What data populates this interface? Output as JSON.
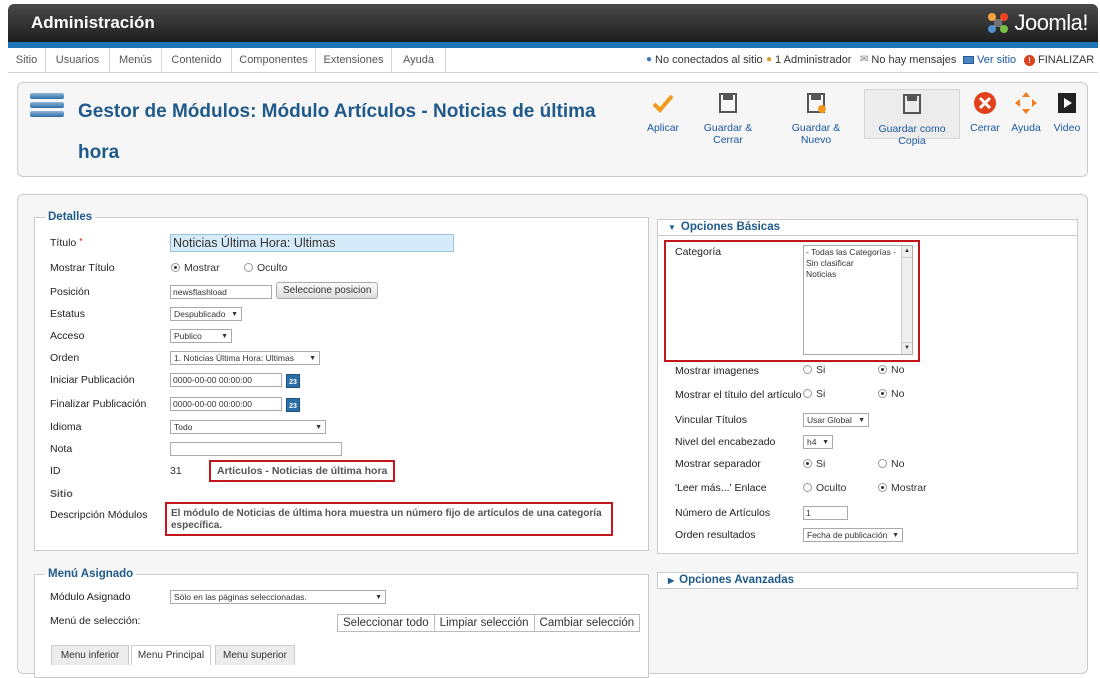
{
  "header": {
    "title": "Administración",
    "logo_text": "Joomla!"
  },
  "menu": [
    "Sitio",
    "Usuarios",
    "Menús",
    "Contenido",
    "Componentes",
    "Extensiones",
    "Ayuda"
  ],
  "status": {
    "offline": "No conectados al sitio",
    "admins": "1 Administrador",
    "messages": "No hay mensajes",
    "view_site": "Ver sitio",
    "logout": "FINALIZAR"
  },
  "page_title": "Gestor de Módulos: Módulo Artículos - Noticias de última hora",
  "toolbar": {
    "apply": "Aplicar",
    "save_close": "Guardar & Cerrar",
    "save_new": "Guardar & Nuevo",
    "save_copy": "Guardar como Copia",
    "close": "Cerrar",
    "help": "Ayuda",
    "video": "Video"
  },
  "details": {
    "legend": "Detalles",
    "title_label": "Título",
    "required_mark": "*",
    "title_value": "Noticias Última Hora: Ultimas",
    "show_title_label": "Mostrar Título",
    "show_title_opt1": "Mostrar",
    "show_title_opt2": "Oculto",
    "position_label": "Posición",
    "position_value": "newsflashload",
    "position_button": "Seleccione posicion",
    "status_label": "Estatus",
    "status_value": "Despublicado",
    "access_label": "Acceso",
    "access_value": "Publico",
    "order_label": "Orden",
    "order_value": "1. Noticias Última Hora: Ultimas",
    "start_label": "Iniciar Publicación",
    "start_value": "0000-00-00 00:00:00",
    "end_label": "Finalizar Publicación",
    "end_value": "0000-00-00 00:00:00",
    "calendar_day": "23",
    "language_label": "Idioma",
    "language_value": "Todo",
    "note_label": "Nota",
    "note_value": "",
    "id_label": "ID",
    "id_value": "31",
    "module_type": "Artículos - Noticias de última hora",
    "site_label": "Sitio",
    "desc_label": "Descripción Módulos",
    "desc_value": "El módulo de Noticias de última hora muestra un número fijo de artículos de una categoría específica."
  },
  "menu_assign": {
    "legend": "Menú Asignado",
    "module_label": "Módulo Asignado",
    "module_value": "Sólo en las páginas seleccionadas.",
    "selection_label": "Menú de selección:",
    "select_all": "Seleccionar todo",
    "clear": "Limpiar selección",
    "toggle": "Cambiar selección",
    "tabs": [
      "Menu inferior",
      "Menu Principal",
      "Menu superior"
    ]
  },
  "basic": {
    "header": "Opciones Básicas",
    "category_label": "Categoría",
    "categories": [
      "- Todas las Categorías -",
      "Sin clasificar",
      "Noticias"
    ],
    "show_images_label": "Mostrar imagenes",
    "show_article_title_label": "Mostrar el título del artículo",
    "yes": "Si",
    "no": "No",
    "link_titles_label": "Vincular Títulos",
    "link_titles_value": "Usar Global",
    "heading_label": "Nivel del encabezado",
    "heading_value": "h4",
    "separator_label": "Mostrar separador",
    "readmore_label": "'Leer más...' Enlace",
    "readmore_opt1": "Oculto",
    "readmore_opt2": "Mostrar",
    "count_label": "Número de Artículos",
    "count_value": "1",
    "order_label": "Orden resultados",
    "order_value": "Fecha de publicación"
  },
  "advanced": {
    "header": "Opciones Avanzadas"
  }
}
